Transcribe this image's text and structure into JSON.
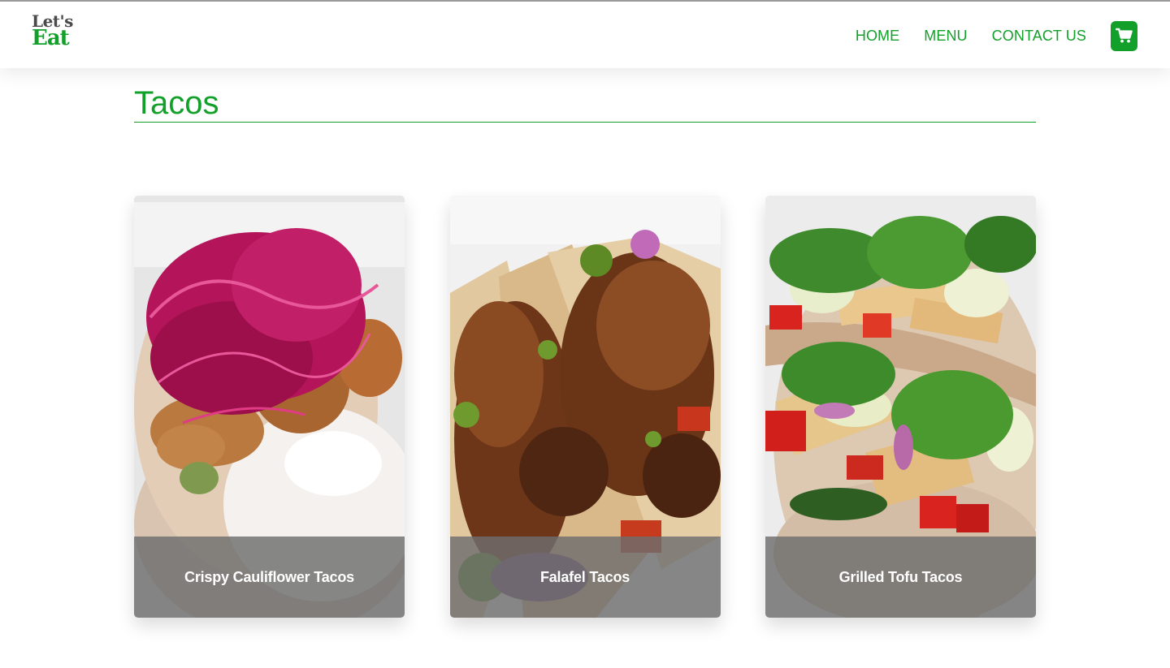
{
  "header": {
    "logo_top": "Let's",
    "logo_bottom": "Eat",
    "nav": {
      "home": "HOME",
      "menu": "MENU",
      "contact": "CONTACT US"
    },
    "cart_icon": "cart-icon"
  },
  "main": {
    "title": "Tacos",
    "cards": [
      {
        "title": "Crispy Cauliflower Tacos"
      },
      {
        "title": "Falafel Tacos"
      },
      {
        "title": "Grilled Tofu Tacos"
      }
    ]
  },
  "colors": {
    "brand_green": "#13a02a",
    "logo_gray": "#4a4a4a",
    "caption_overlay": "#6e6e6e"
  }
}
